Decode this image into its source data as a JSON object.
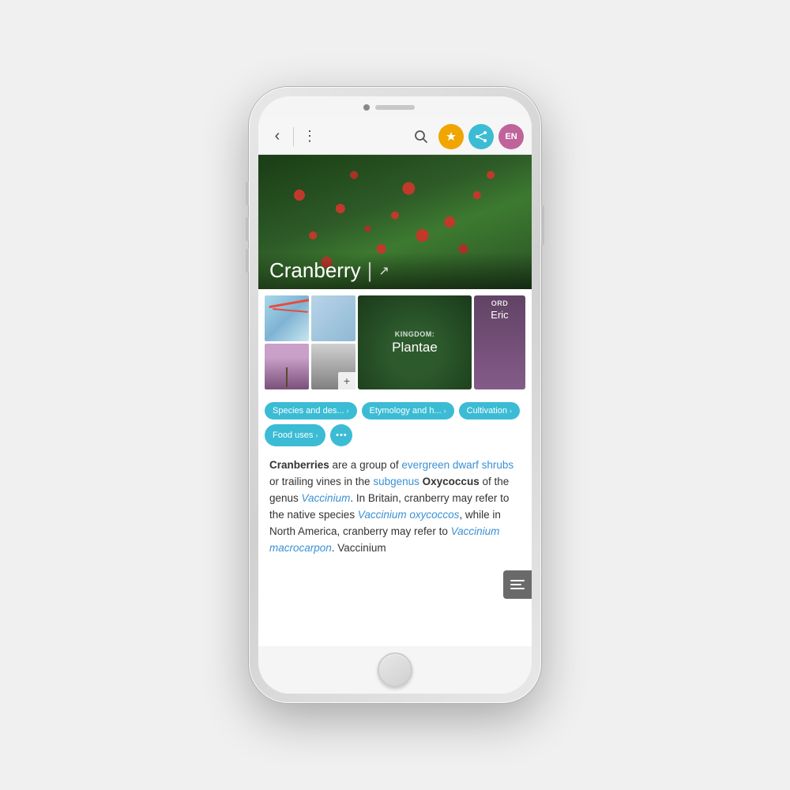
{
  "phone": {
    "speaker_label": "speaker",
    "camera_label": "camera"
  },
  "toolbar": {
    "back_label": "‹",
    "menu_label": "⋮",
    "search_label": "○",
    "torch_btn_color": "#f0a500",
    "share_btn_color": "#3bbcd4",
    "lang_btn_color": "#c0639a",
    "lang_label": "EN"
  },
  "hero": {
    "title": "Cranberry",
    "divider": "|",
    "share_icon": "↗"
  },
  "gallery": {
    "kingdom_tag": "KINGDOM:",
    "kingdom_value": "Plantae",
    "order_tag": "ORD",
    "order_value": "Eric",
    "add_icon": "+"
  },
  "chips": [
    {
      "label": "Species and des...",
      "arrow": "›"
    },
    {
      "label": "Etymology and h...",
      "arrow": "›"
    },
    {
      "label": "Cultivation",
      "arrow": "›"
    },
    {
      "label": "Food uses",
      "arrow": "›"
    },
    {
      "more": "···"
    }
  ],
  "article": {
    "bold_start": "Cranberries",
    "text1": " are a group of ",
    "link1": "evergreen dwarf shrubs",
    "text2": " or trailing vines in the ",
    "link2": "subgenus",
    "bold2": " Oxycoccus",
    "text3": " of the genus ",
    "link3": "Vaccinium",
    "text4": ". In Britain, cranberry may refer to the native species ",
    "link4": "Vaccinium oxycoccos",
    "text5": ", while in North America, cranberry may refer to ",
    "link5": "Vaccinium macrocarpon",
    "text6": ". Vaccinium"
  }
}
